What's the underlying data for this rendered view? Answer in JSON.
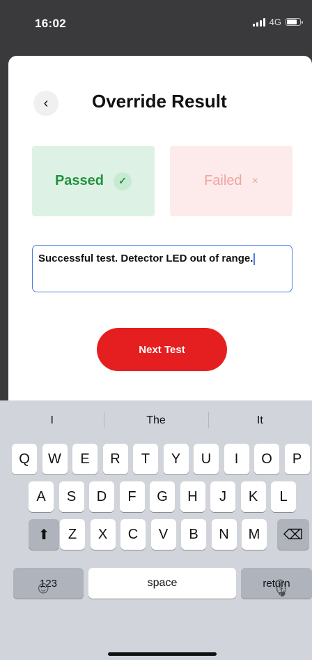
{
  "status_bar": {
    "time": "16:02",
    "network": "4G",
    "icons": [
      "signal-icon",
      "battery-icon"
    ]
  },
  "header": {
    "back_icon": "‹",
    "title": "Override Result"
  },
  "results": {
    "passed_label": "Passed",
    "passed_icon": "✓",
    "failed_label": "Failed",
    "failed_icon": "×",
    "selected": "Passed"
  },
  "notes": {
    "value": "Successful test. Detector LED out of range."
  },
  "actions": {
    "next_label": "Next Test"
  },
  "keyboard": {
    "suggestions": [
      "I",
      "The",
      "It"
    ],
    "row1": [
      "Q",
      "W",
      "E",
      "R",
      "T",
      "Y",
      "U",
      "I",
      "O",
      "P"
    ],
    "row2": [
      "A",
      "S",
      "D",
      "F",
      "G",
      "H",
      "J",
      "K",
      "L"
    ],
    "row3": [
      "Z",
      "X",
      "C",
      "V",
      "B",
      "N",
      "M"
    ],
    "shift_icon": "⬆",
    "delete_icon": "⌫",
    "numbers_label": "123",
    "space_label": "space",
    "return_label": "return",
    "emoji_icon": "☺",
    "mic_icon": "🎙"
  },
  "colors": {
    "accent_red": "#e51f1f",
    "passed_green": "#23913f",
    "focus_blue": "#4a7de0"
  }
}
